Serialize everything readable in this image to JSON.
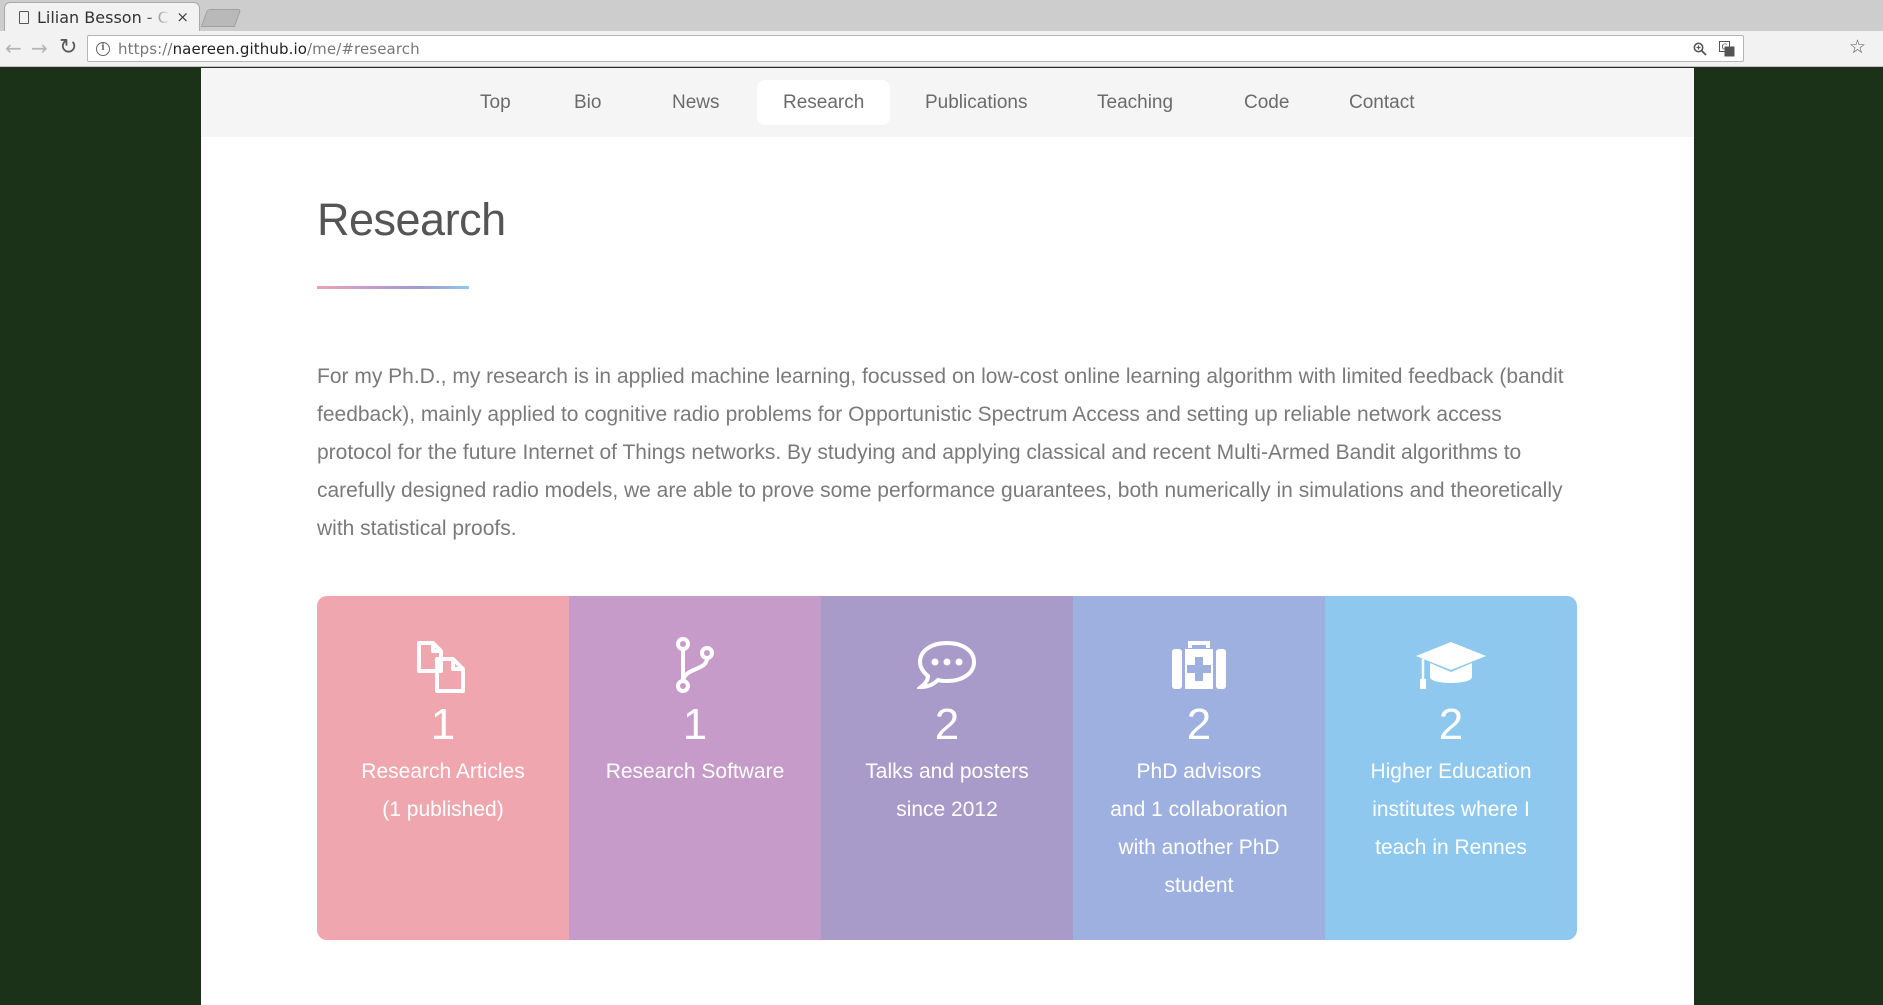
{
  "browser": {
    "tab_title": "Lilian Besson - Ce",
    "tab_close": "×",
    "url_scheme": "https://",
    "url_host": "naereen.github.io",
    "url_path": "/me/#research",
    "back_glyph": "←",
    "forward_glyph": "→",
    "reload_glyph": "↻",
    "zoom_glyph": "🔍",
    "translate_glyph": "文",
    "star_glyph": "☆"
  },
  "nav": {
    "items": [
      {
        "label": "Top",
        "active": false
      },
      {
        "label": "Bio",
        "active": false
      },
      {
        "label": "News",
        "active": false
      },
      {
        "label": "Research",
        "active": true
      },
      {
        "label": "Publications",
        "active": false
      },
      {
        "label": "Teaching",
        "active": false
      },
      {
        "label": "Code",
        "active": false
      },
      {
        "label": "Contact",
        "active": false
      }
    ]
  },
  "section": {
    "title": "Research",
    "intro": "For my Ph.D., my research is in applied machine learning, focussed on low-cost online learning algorithm with limited feedback (bandit feedback), mainly applied to cognitive radio problems for Opportunistic Spectrum Access and setting up reliable network access protocol for the future Internet of Things networks. By studying and applying classical and recent Multi-Armed Bandit algorithms to carefully designed radio models, we are able to prove some performance guarantees, both numerically in simulations and theoretically with statistical proofs."
  },
  "stats": [
    {
      "icon": "files-icon",
      "number": "1",
      "line1": "Research Articles",
      "line2": "(1 published)",
      "line3": "",
      "line4": "",
      "color": "#f0a6ae"
    },
    {
      "icon": "code-fork-icon",
      "number": "1",
      "line1": "Research Software",
      "line2": "",
      "line3": "",
      "line4": "",
      "color": "#c79bc9"
    },
    {
      "icon": "speech-bubble-icon",
      "number": "2",
      "line1": "Talks and posters",
      "line2": "since 2012",
      "line3": "",
      "line4": "",
      "color": "#a89bc9"
    },
    {
      "icon": "medkit-icon",
      "number": "2",
      "line1": "PhD advisors",
      "line2": "and 1 collaboration",
      "line3": "with another PhD",
      "line4": "student",
      "color": "#9db0df"
    },
    {
      "icon": "graduation-cap-icon",
      "number": "2",
      "line1": "Higher Education",
      "line2": "institutes where I",
      "line3": "teach in Rennes",
      "line4": "",
      "color": "#8ec8ee"
    }
  ]
}
